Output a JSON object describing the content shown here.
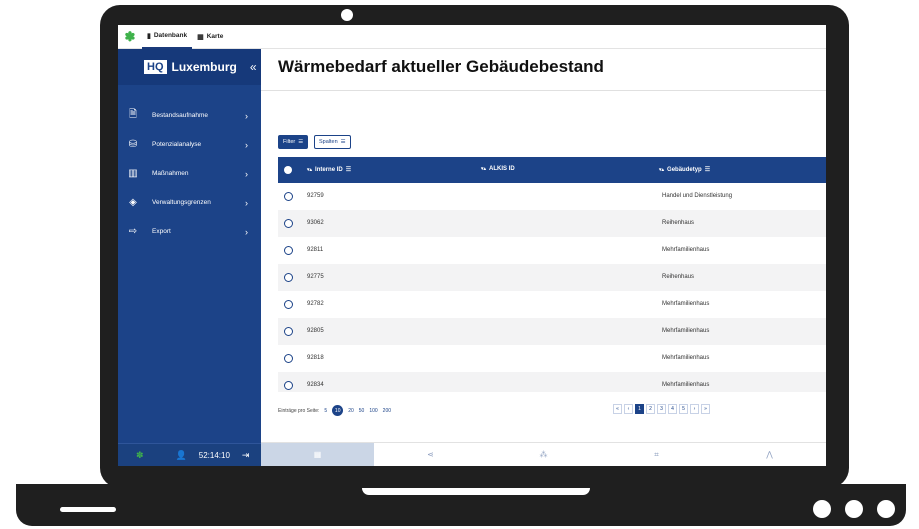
{
  "colors": {
    "primary": "#1c4388",
    "brand_dark": "#16397a",
    "accent_green": "#3fb24b",
    "row_alt": "#f3f3f4"
  },
  "topbar": {
    "logo_icon": "leaf-icon",
    "tabs": [
      {
        "label": "Datenbank",
        "icon": "database-icon"
      },
      {
        "label": "Karte",
        "icon": "map-icon"
      }
    ]
  },
  "sidebar": {
    "brand": {
      "hq": "HQ",
      "name": "Luxemburg",
      "collapse": "«"
    },
    "items": [
      {
        "label": "Bestandsaufnahme",
        "icon": "document-icon",
        "chevron": "›"
      },
      {
        "label": "Potenzialanalyse",
        "icon": "database-icon",
        "chevron": "›"
      },
      {
        "label": "Maßnahmen",
        "icon": "buildings-icon",
        "chevron": "›"
      },
      {
        "label": "Verwaltungsgrenzen",
        "icon": "layers-icon",
        "chevron": "›"
      },
      {
        "label": "Export",
        "icon": "export-icon",
        "chevron": "›"
      }
    ],
    "footer": {
      "time": "52:14:10"
    }
  },
  "main": {
    "title": "Wärmebedarf aktueller Gebäudebestand",
    "toolbar": {
      "filter_label": "Filter",
      "columns_label": "Spalten"
    },
    "table": {
      "headers": [
        "Interne ID",
        "ALKIS ID",
        "Gebäudetyp"
      ],
      "rows": [
        {
          "id": "92759",
          "alkis": "",
          "type": "Handel und Dienstleistung"
        },
        {
          "id": "93062",
          "alkis": "",
          "type": "Reihenhaus"
        },
        {
          "id": "92811",
          "alkis": "",
          "type": "Mehrfamilienhaus"
        },
        {
          "id": "92775",
          "alkis": "",
          "type": "Reihenhaus"
        },
        {
          "id": "92782",
          "alkis": "",
          "type": "Mehrfamilienhaus"
        },
        {
          "id": "92805",
          "alkis": "",
          "type": "Mehrfamilienhaus"
        },
        {
          "id": "92818",
          "alkis": "",
          "type": "Mehrfamilienhaus"
        },
        {
          "id": "92834",
          "alkis": "",
          "type": "Mehrfamilienhaus"
        }
      ]
    },
    "pagination": {
      "entries_label": "Einträge pro Seite:",
      "sizes": [
        "5",
        "10",
        "20",
        "50",
        "100",
        "200"
      ],
      "selected_size": "10",
      "first": "«",
      "prev": "‹",
      "pages": [
        "1",
        "2",
        "3",
        "4",
        "5"
      ],
      "current_page": "1",
      "next": "›",
      "last": "»"
    },
    "bottom_nav": [
      "table-icon",
      "share-icon",
      "network-icon",
      "crop-icon",
      "road-icon"
    ]
  }
}
